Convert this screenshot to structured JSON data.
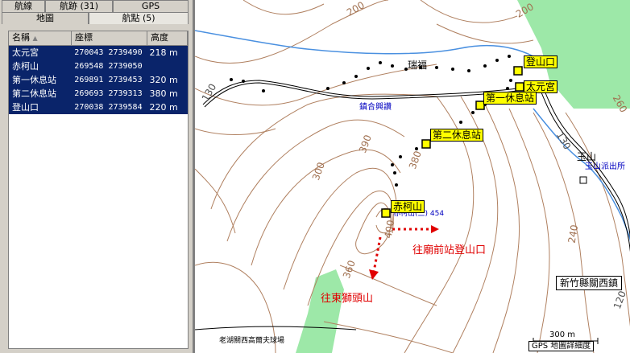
{
  "tabs_top": [
    "航線",
    "航跡 (31)",
    "GPS"
  ],
  "tabs_bottom": [
    "地圖",
    "航點 (5)"
  ],
  "list": {
    "headers": [
      "名稱",
      "座標",
      "高度"
    ],
    "sort_icon": "▲",
    "rows": [
      {
        "name": "太元宮",
        "coord": "270043 2739490",
        "alt": "218 m"
      },
      {
        "name": "赤柯山",
        "coord": "269548 2739050",
        "alt": ""
      },
      {
        "name": "第一休息站",
        "coord": "269891 2739453",
        "alt": "320 m"
      },
      {
        "name": "第二休息站",
        "coord": "269693 2739313",
        "alt": "380 m"
      },
      {
        "name": "登山口",
        "coord": "270038 2739584",
        "alt": "220 m"
      }
    ]
  },
  "map": {
    "contours": [
      "200",
      "200",
      "130",
      "260",
      "390",
      "300",
      "380",
      "400",
      "360",
      "240",
      "130",
      "120"
    ],
    "places": {
      "ruifu": "瑞福",
      "temple": "鎮合興讚",
      "yushan": "玉山",
      "yushan_station": "玉山派出所",
      "summit_label": "赤柯山(三) 454",
      "road_bottom": "老湖關西高爾夫球場",
      "village": "新竹縣關西鎮",
      "scale": "300 m",
      "precision": "GPS 地圖詳細度"
    },
    "waypoints": [
      "登山口",
      "太元宮",
      "第一休息站",
      "第二休息站",
      "赤柯山"
    ],
    "directions": [
      "往廟前站登山口",
      "往東獅頭山"
    ]
  }
}
